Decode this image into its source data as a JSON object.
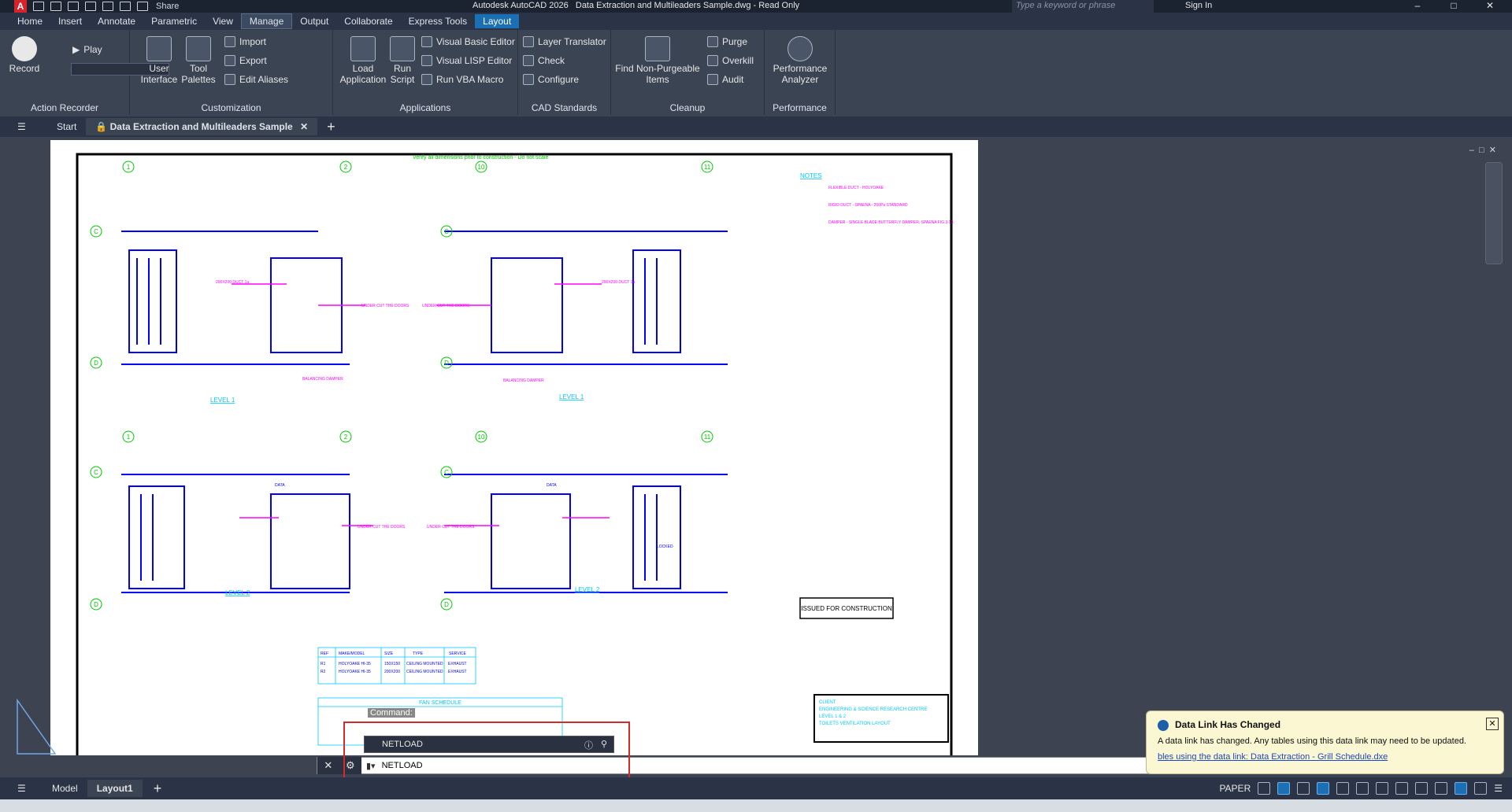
{
  "app": {
    "title": "Autodesk AutoCAD 2026",
    "file": "Data Extraction and Multileaders Sample.dwg - Read Only",
    "logo": "A",
    "share": "Share",
    "search_placeholder": "Type a keyword or phrase",
    "sign_in": "Sign In"
  },
  "ribbon_tabs": [
    "Home",
    "Insert",
    "Annotate",
    "Parametric",
    "View",
    "Manage",
    "Output",
    "Collaborate",
    "Express Tools",
    "Layout"
  ],
  "panels": {
    "action_recorder": {
      "record": "Record",
      "play": "Play",
      "label": "Action Recorder"
    },
    "customization": {
      "user_interface": "User Interface",
      "tool_palettes": "Tool Palettes",
      "import": "Import",
      "export": "Export",
      "edit_aliases": "Edit Aliases",
      "label": "Customization"
    },
    "applications": {
      "load_application": "Load Application",
      "run_script": "Run Script",
      "vba_editor": "Visual Basic Editor",
      "lisp_editor": "Visual LISP Editor",
      "run_vba": "Run VBA Macro",
      "label": "Applications"
    },
    "cad_standards": {
      "layer_translator": "Layer Translator",
      "check": "Check",
      "configure": "Configure",
      "label": "CAD Standards"
    },
    "cleanup": {
      "find": "Find Non-Purgeable Items",
      "purge": "Purge",
      "overkill": "Overkill",
      "audit": "Audit",
      "label": "Cleanup"
    },
    "performance": {
      "analyzer": "Performance Analyzer",
      "label": "Performance"
    }
  },
  "doc_tabs": {
    "start": "Start",
    "active": "Data Extraction and Multileaders Sample"
  },
  "drawing": {
    "top_note": "Verify all dimensions prior to construction - Do not scale",
    "notes_title": "NOTES",
    "notes": [
      "FLEXIBLE DUCT - HOLYOAKE",
      "RIGID DUCT - SPAENA - 250Pa STANDARD",
      "DAMPER - SINGLE BLADE BUTTERFLY DAMPER, SPAENA FIG 3-13."
    ],
    "level_labels": [
      "LEVEL 1",
      "LEVEL 1",
      "LEVEL 2",
      "LEVEL 2"
    ],
    "grid_labels": [
      "1",
      "2",
      "10",
      "11",
      "C",
      "D",
      "C",
      "D",
      "1",
      "2",
      "10",
      "11",
      "C",
      "D",
      "C",
      "D"
    ],
    "annotations": [
      "200X200 DUCT 1a",
      "UNDER CUT THE DOORS",
      "BALANCING DAMPER",
      "200X200 DUCT 1a",
      "UNDER CUT THE DOORS",
      "BALANCING DAMPER",
      "DATA",
      "UNDER CUT THE DOORS",
      "DATA",
      "UNDER CUT THE DOORS",
      "LOCKED"
    ],
    "issued": "ISSUED FOR CONSTRUCTION",
    "fan_schedule_title": "FAN SCHEDULE",
    "table_headers": [
      "REF",
      "MAKE/MODEL",
      "SIZE",
      "TYPE",
      "SERVICE"
    ],
    "table_rows": [
      [
        "R1",
        "HOLYOAKE HI-35",
        "150X150",
        "CEILING MOUNTED",
        "EXHAUST"
      ],
      [
        "R2",
        "HOLYOAKE HI-35",
        "200X200",
        "CEILING MOUNTED",
        "EXHAUST"
      ]
    ],
    "title_block": [
      "CLIENT",
      "ENGINEERING & SCIENCE RESEARCH CENTRE",
      "LEVEL 1 & 2",
      "TOILETS VENTILATION LAYOUT"
    ]
  },
  "command": {
    "history": "NETLOAD",
    "history_prefix": "Command:",
    "input_value": "NETLOAD"
  },
  "notification": {
    "title": "Data Link Has Changed",
    "body": "A data link has changed.  Any tables using this data link may need to be updated.",
    "link": "bles using the data link: Data Extraction - Grill Schedule.dxe"
  },
  "status": {
    "tabs": [
      "Model",
      "Layout1"
    ],
    "space": "PAPER"
  }
}
